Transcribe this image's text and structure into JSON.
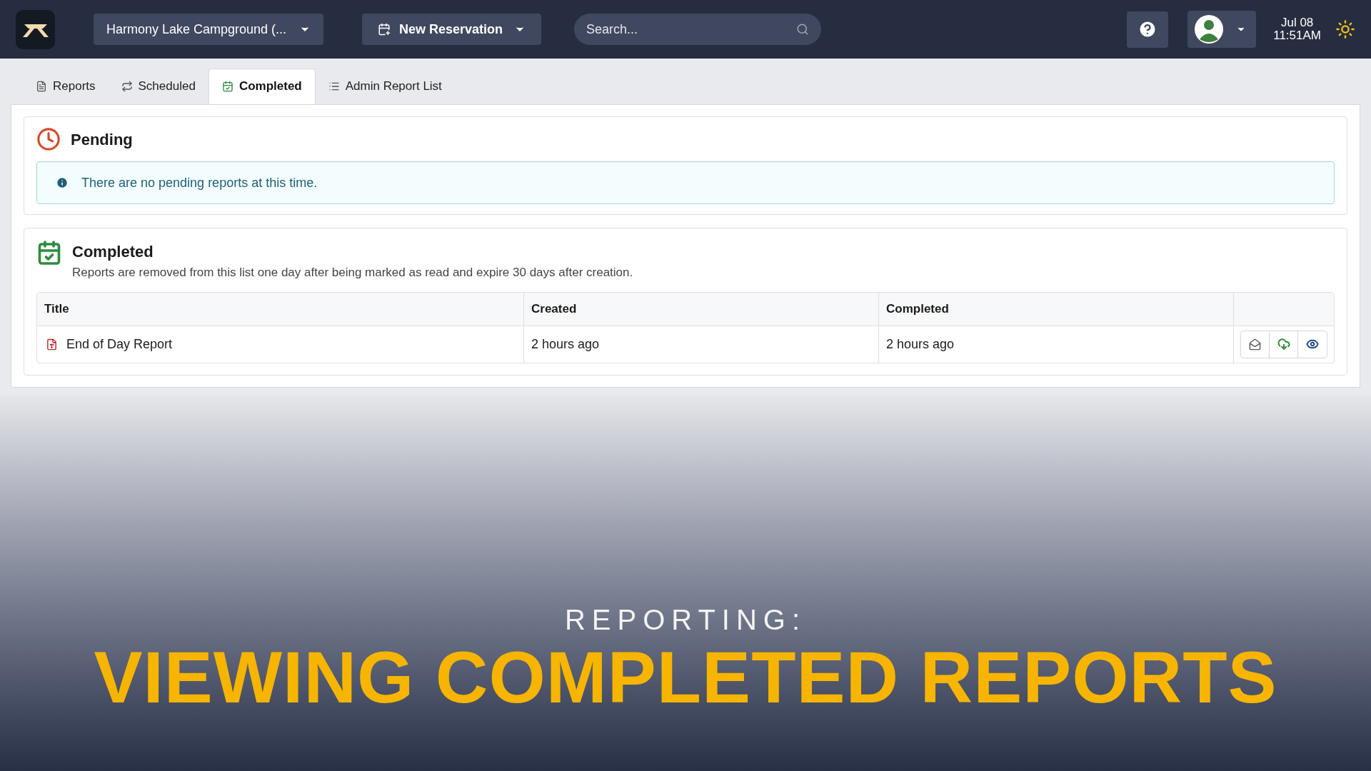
{
  "top_bar": {
    "campground_select": "Harmony Lake Campground (...",
    "new_reservation": "New Reservation",
    "search": {
      "placeholder": "Search..."
    },
    "date": "Jul 08",
    "time": "11:51AM"
  },
  "tabs": [
    {
      "label": "Reports",
      "selected": false
    },
    {
      "label": "Scheduled",
      "selected": false
    },
    {
      "label": "Completed",
      "selected": true
    },
    {
      "label": "Admin Report List",
      "selected": false
    }
  ],
  "pending": {
    "title": "Pending",
    "alert": "There are no pending reports at this time."
  },
  "completed": {
    "title": "Completed",
    "description": "Reports are removed from this list one day after being marked as read and expire 30 days after creation.",
    "table": {
      "columns": [
        "Title",
        "Created",
        "Completed"
      ],
      "rows": [
        {
          "title": "End of Day Report",
          "created": "2 hours ago",
          "completed": "2 hours ago"
        }
      ]
    }
  },
  "overlay": {
    "kicker": "REPORTING:",
    "headline": "VIEWING COMPLETED REPORTS"
  }
}
